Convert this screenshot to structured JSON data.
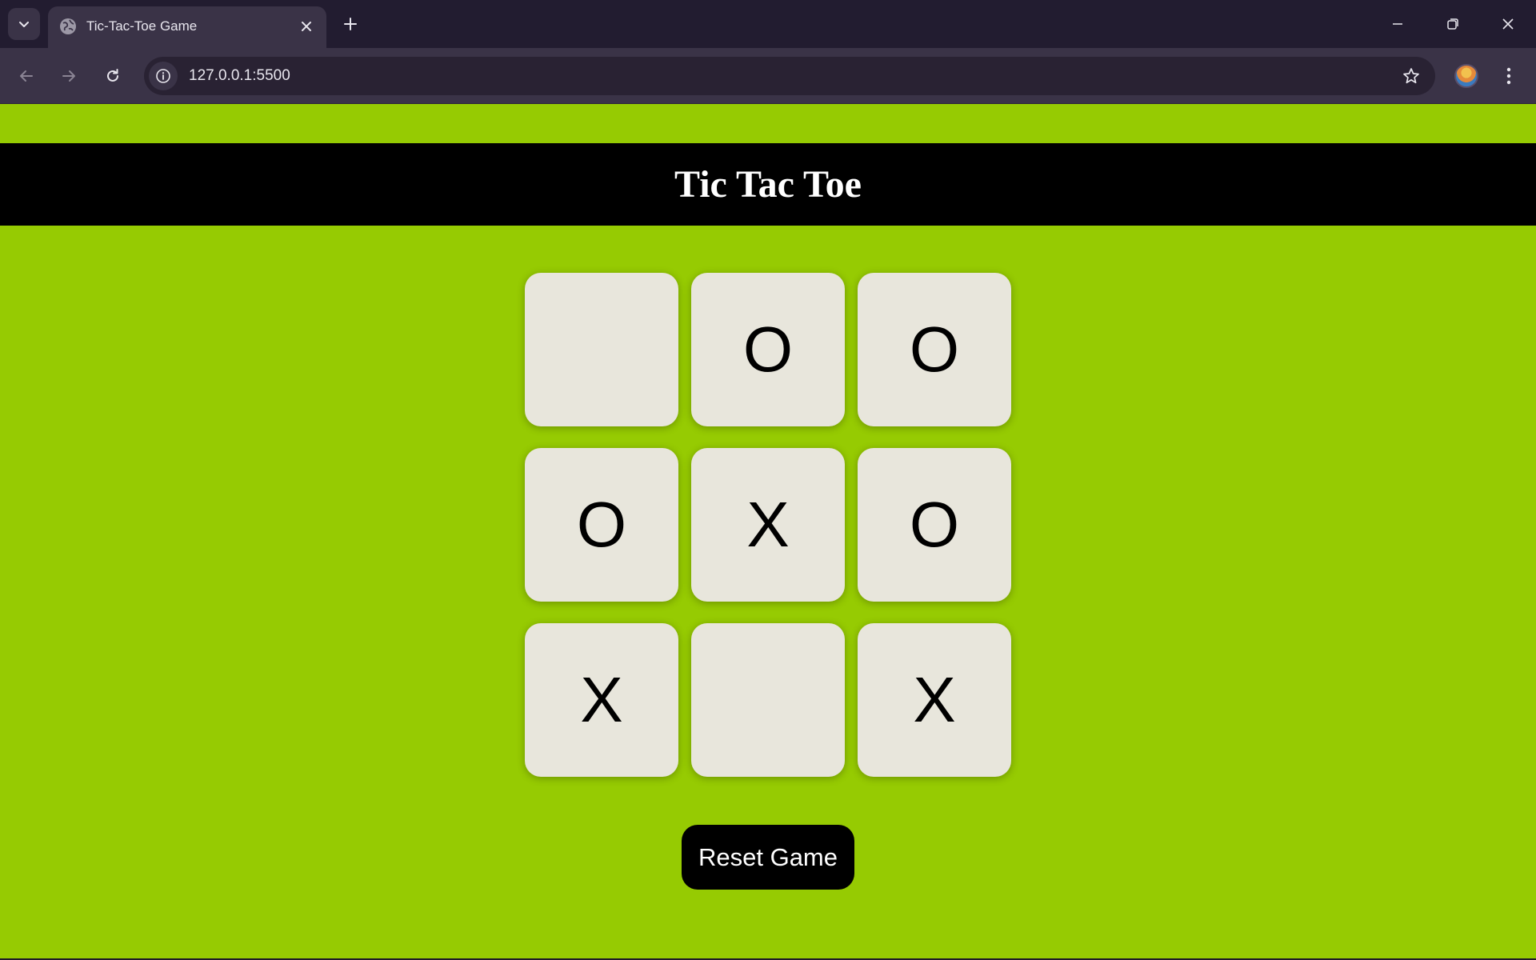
{
  "browser": {
    "tab_title": "Tic-Tac-Toe Game",
    "url": "127.0.0.1:5500"
  },
  "page": {
    "title": "Tic Tac Toe",
    "board": [
      "",
      "O",
      "O",
      "O",
      "X",
      "O",
      "X",
      "",
      "X"
    ],
    "reset_label": "Reset Game"
  },
  "colors": {
    "background": "#96cb02",
    "header": "#000000",
    "cell": "#e8e6dc",
    "button": "#000000"
  },
  "icons": {
    "tab_menu": "chevron-down-icon",
    "favicon": "globe-icon",
    "tab_close": "close-icon",
    "new_tab": "plus-icon",
    "back": "arrow-left-icon",
    "forward": "arrow-right-icon",
    "reload": "reload-icon",
    "site_info": "info-icon",
    "bookmark": "star-icon",
    "menu": "kebab-icon"
  }
}
